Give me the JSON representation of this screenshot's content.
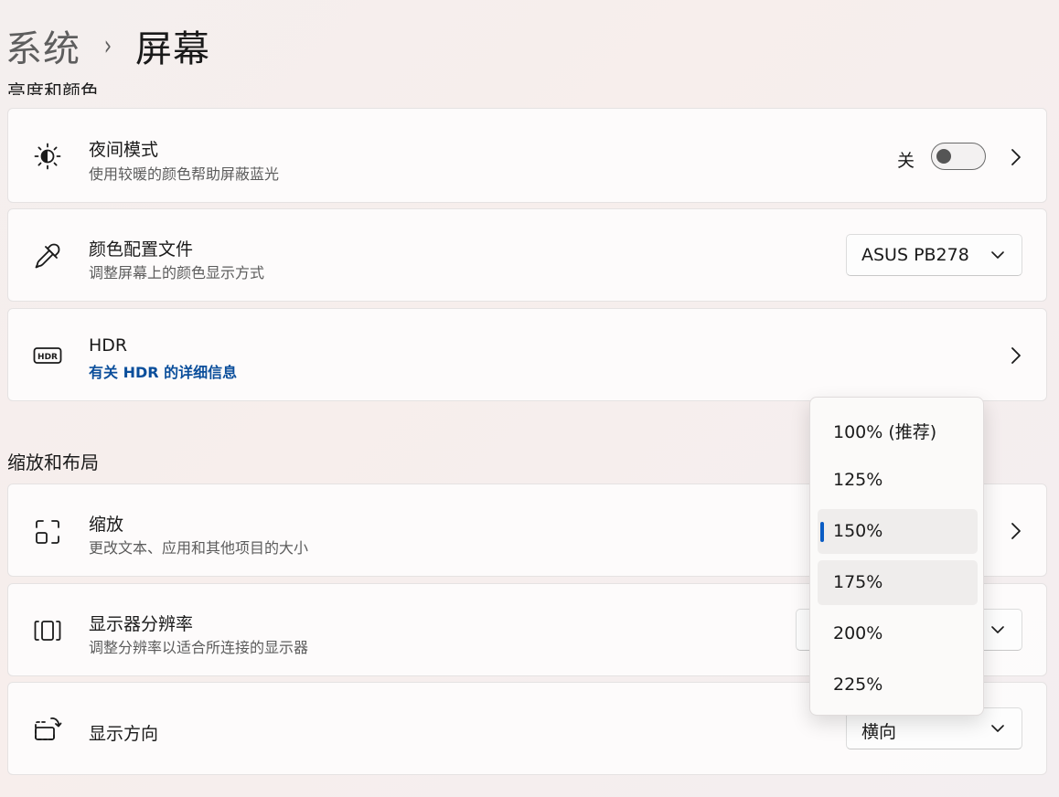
{
  "breadcrumb": {
    "parent": "系统",
    "separator": "›",
    "current": "屏幕"
  },
  "clipped_heading": "亮度和颜色",
  "night_light": {
    "title": "夜间模式",
    "subtitle": "使用较暖的颜色帮助屏蔽蓝光",
    "state_label": "关",
    "toggle_on": false
  },
  "color_profile": {
    "title": "颜色配置文件",
    "subtitle": "调整屏幕上的颜色显示方式",
    "value": "ASUS PB278"
  },
  "hdr": {
    "title": "HDR",
    "link": "有关 HDR 的详细信息",
    "icon_text": "HDR"
  },
  "scale_layout_heading": "缩放和布局",
  "scale": {
    "title": "缩放",
    "subtitle": "更改文本、应用和其他项目的大小"
  },
  "resolution": {
    "title": "显示器分辨率",
    "subtitle": "调整分辨率以适合所连接的显示器"
  },
  "orientation": {
    "title": "显示方向",
    "value": "横向"
  },
  "scale_menu": {
    "items": [
      "100% (推荐)",
      "125%",
      "150%",
      "175%",
      "200%",
      "225%"
    ],
    "selected": "150%",
    "hovered": "175%"
  },
  "colors": {
    "accent": "#0a5cc4",
    "link": "#0a4e9b"
  }
}
